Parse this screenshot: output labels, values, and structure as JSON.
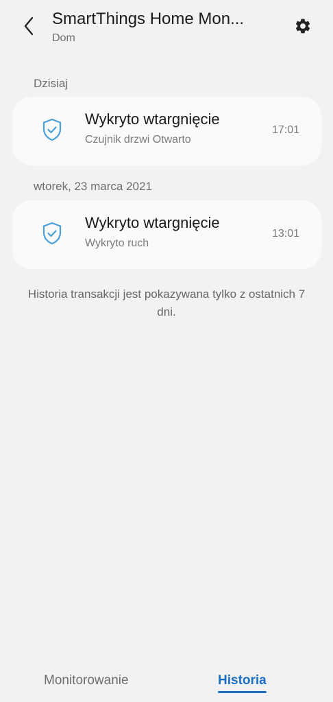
{
  "header": {
    "title": "SmartThings Home Mon...",
    "subtitle": "Dom"
  },
  "icons": {
    "back": "chevron-left-icon",
    "settings": "gear-icon",
    "event": "shield-check-icon"
  },
  "colors": {
    "accent": "#1a6fc4",
    "shield": "#4a9fd8",
    "background": "#f2f2f2",
    "card": "#fafafa"
  },
  "sections": [
    {
      "label": "Dzisiaj",
      "events": [
        {
          "title": "Wykryto wtargnięcie",
          "subtitle": "Czujnik drzwi Otwarto",
          "time": "17:01"
        }
      ]
    },
    {
      "label": "wtorek, 23 marca 2021",
      "events": [
        {
          "title": "Wykryto wtargnięcie",
          "subtitle": "Wykryto ruch",
          "time": "13:01"
        }
      ]
    }
  ],
  "note": "Historia transakcji jest pokazywana tylko z ostatnich 7 dni.",
  "tabs": [
    {
      "label": "Monitorowanie",
      "active": false
    },
    {
      "label": "Historia",
      "active": true
    }
  ]
}
